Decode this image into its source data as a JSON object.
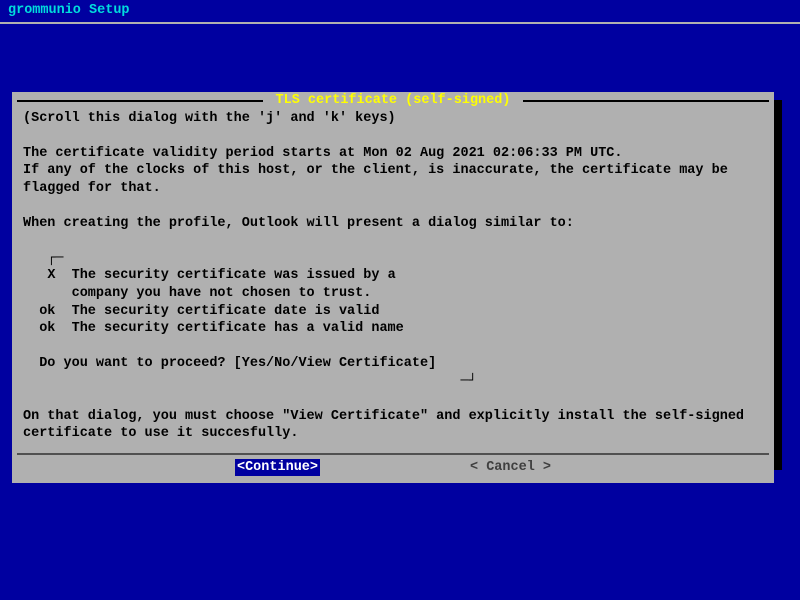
{
  "header": {
    "title": "grommunio Setup"
  },
  "dialog": {
    "title": "TLS certificate (self-signed)",
    "scroll_hint": "(Scroll this dialog with the 'j' and 'k' keys)",
    "para1": "The certificate validity period starts at Mon 02 Aug 2021 02:06:33 PM UTC.\nIf any of the clocks of this host, or the client, is inaccurate, the certificate may be flagged for that.",
    "para2": "When creating the profile, Outlook will present a dialog similar to:",
    "sim": {
      "tl_corner": "┌─",
      "line1": "   X  The security certificate was issued by a",
      "line1b": "      company you have not chosen to trust.",
      "line2": "  ok  The security certificate date is valid",
      "line3": "  ok  The security certificate has a valid name",
      "prompt": "  Do you want to proceed? [Yes/No/View Certificate]",
      "br_corner": "─┘"
    },
    "para3": "On that dialog, you must choose \"View Certificate\" and explicitly install the self-signed certificate to use it succesfully.",
    "continue_label": "<Continue>",
    "cancel_label": "< Cancel >"
  }
}
